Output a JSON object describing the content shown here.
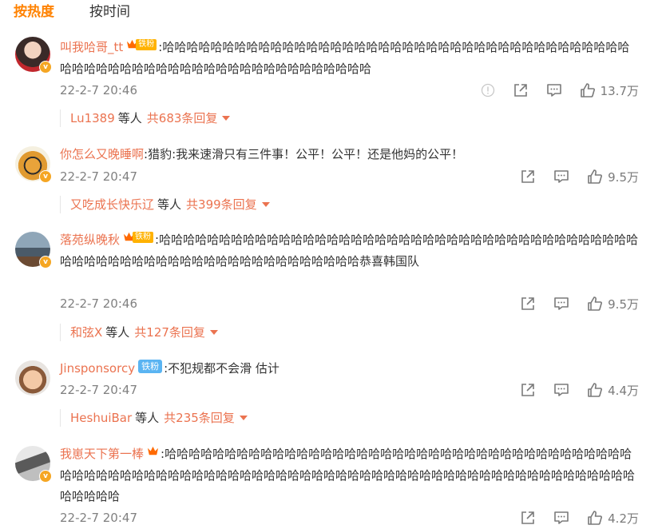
{
  "tabs": {
    "hot": "按热度",
    "time": "按时间"
  },
  "comments": [
    {
      "username": "叫我哈哥_tt",
      "fan_badge": "铁粉",
      "text": ":哈哈哈哈哈哈哈哈哈哈哈哈哈哈哈哈哈哈哈哈哈哈哈哈哈哈哈哈哈哈哈哈哈哈哈哈哈哈哈哈哈哈哈哈哈哈哈哈哈哈哈哈哈哈哈哈哈哈哈哈哈哈哈哈哈",
      "time": "22-2-7 20:46",
      "likes": "13.7万",
      "reply_user": "Lu1389",
      "reply_etc": "等人",
      "reply_total": "共683条回复"
    },
    {
      "username": "你怎么又晚睡啊",
      "text": ":猎豹:我来速滑只有三件事！公平！公平！还是他妈的公平！",
      "time": "22-2-7 20:47",
      "likes": "9.5万",
      "reply_user": "又吃成长快乐辽",
      "reply_etc": "等人",
      "reply_total": "共399条回复"
    },
    {
      "username": "落苑纵晚秋",
      "fan_badge": "铁粉",
      "text": ":哈哈哈哈哈哈哈哈哈哈哈哈哈哈哈哈哈哈哈哈哈哈哈哈哈哈哈哈哈哈哈哈哈哈哈哈哈哈哈哈哈哈哈哈哈哈哈哈哈哈哈哈哈哈哈哈哈哈哈哈哈哈哈哈哈恭喜韩国队",
      "time": "22-2-7 20:46",
      "likes": "9.5万",
      "reply_user": "和弦X",
      "reply_etc": "等人",
      "reply_total": "共127条回复"
    },
    {
      "username": "Jinsponsorcy",
      "fan_badge": "铁粉",
      "text": ":不犯规都不会滑 估计",
      "time": "22-2-7 20:47",
      "likes": "4.4万",
      "reply_user": "HeshuiBar",
      "reply_etc": "等人",
      "reply_total": "共235条回复"
    },
    {
      "username": "我崽天下第一棒",
      "text": ":哈哈哈哈哈哈哈哈哈哈哈哈哈哈哈哈哈哈哈哈哈哈哈哈哈哈哈哈哈哈哈哈哈哈哈哈哈哈哈哈哈哈哈哈哈哈哈哈哈哈哈哈哈哈哈哈哈哈哈哈哈哈哈哈哈哈哈哈哈哈哈哈哈哈哈哈哈哈哈哈哈哈哈哈哈哈哈哈哈哈哈哈",
      "time": "22-2-7 20:47",
      "likes": "4.2万"
    }
  ],
  "colors": {
    "accent": "#ff8200",
    "username": "#eb7350",
    "fan_badge_gold": "#ffb200",
    "fan_badge_blue": "#5ab4f2"
  }
}
